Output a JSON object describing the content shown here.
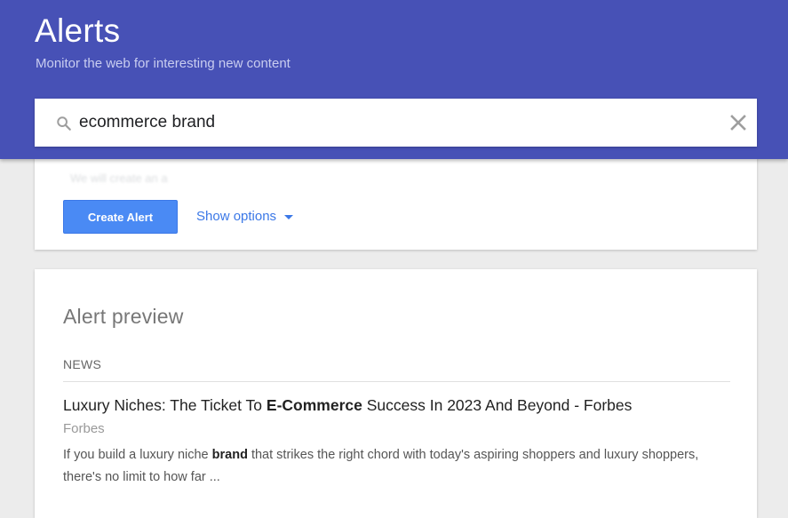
{
  "header": {
    "title": "Alerts",
    "subtitle": "Monitor the web for interesting new content"
  },
  "search": {
    "value": "ecommerce brand",
    "icon": "search-icon",
    "clear_icon": "close-icon"
  },
  "options_card": {
    "create_button_label": "Create Alert",
    "show_options_label": "Show options",
    "show_options_icon": "caret-down-icon",
    "faded_text": "We will create an a"
  },
  "preview": {
    "title": "Alert preview",
    "section_label": "NEWS",
    "article": {
      "title_before": "Luxury Niches: The Ticket To ",
      "title_bold": "E-Commerce",
      "title_after": " Success In 2023 And Beyond - Forbes",
      "source": "Forbes",
      "snippet_before": "If you build a luxury niche ",
      "snippet_bold": "brand",
      "snippet_after": " that strikes the right chord with today's aspiring shoppers and luxury shoppers, there's no limit to how far ..."
    }
  },
  "colors": {
    "header_bg": "#4751b6",
    "button_bg": "#4a8af4",
    "link": "#3b78e7",
    "page_bg": "#ececec"
  }
}
